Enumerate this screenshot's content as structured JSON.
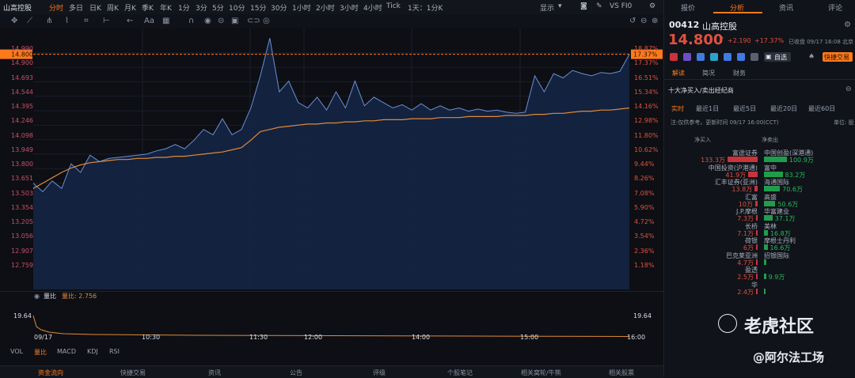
{
  "topbar": {
    "title": "山高控股",
    "periods": [
      "分时",
      "多日",
      "日K",
      "周K",
      "月K",
      "季K",
      "年K",
      "1分",
      "3分",
      "5分",
      "10分",
      "15分",
      "30分",
      "1小时",
      "2小时",
      "3小时",
      "4小时",
      "Tick",
      "1天：1分K"
    ],
    "active_period": "分时",
    "right_items": {
      "display": "显示",
      "vs": "VS FI0"
    }
  },
  "chart": {
    "y_left": [
      "14.990",
      "14.900",
      "14.693",
      "14.544",
      "14.395",
      "14.246",
      "14.098",
      "13.949",
      "13.800",
      "13.651",
      "13.503",
      "13.354",
      "13.205",
      "13.056",
      "12.907",
      "12.759"
    ],
    "y_right": [
      "18.87%",
      "17.37%",
      "16.51%",
      "15.34%",
      "14.16%",
      "12.98%",
      "11.80%",
      "10.62%",
      "9.44%",
      "8.26%",
      "7.08%",
      "5.90%",
      "4.72%",
      "3.54%",
      "2.36%",
      "1.18%"
    ],
    "current_price_label": "14.800",
    "current_pct_label": "17.37%"
  },
  "chart_data": {
    "type": "line",
    "title": "",
    "xlabel": "",
    "ylabel": "",
    "x_ticks": [
      "09/17",
      "10:30",
      "11:30",
      "12:00",
      "14:00",
      "15:00",
      "16:00"
    ],
    "ylim": [
      12.61,
      15.04
    ],
    "series": [
      {
        "values": [
          13.6,
          13.52,
          13.62,
          13.55,
          13.78,
          13.7,
          13.86,
          13.8,
          13.83,
          13.84,
          13.85,
          13.86,
          13.87,
          13.9,
          13.92,
          13.96,
          13.92,
          14.0,
          14.1,
          14.05,
          14.2,
          14.05,
          14.1,
          14.3,
          14.6,
          14.95,
          14.45,
          14.55,
          14.35,
          14.3,
          14.4,
          14.28,
          14.45,
          14.3,
          14.55,
          14.32,
          14.4,
          14.35,
          14.3,
          14.33,
          14.28,
          14.34,
          14.28,
          14.32,
          14.28,
          14.3,
          14.27,
          14.29,
          14.27,
          14.28,
          14.26,
          14.25,
          14.26,
          14.6,
          14.45,
          14.62,
          14.58,
          14.65,
          14.62,
          14.6,
          14.63,
          14.62,
          14.64,
          14.8
        ]
      },
      {
        "values": [
          13.55,
          13.6,
          13.65,
          13.7,
          13.74,
          13.77,
          13.79,
          13.8,
          13.81,
          13.82,
          13.82,
          13.83,
          13.83,
          13.84,
          13.84,
          13.85,
          13.85,
          13.86,
          13.87,
          13.88,
          13.89,
          13.91,
          13.93,
          14.0,
          14.08,
          14.1,
          14.12,
          14.13,
          14.14,
          14.15,
          14.15,
          14.16,
          14.16,
          14.17,
          14.17,
          14.18,
          14.18,
          14.19,
          14.19,
          14.19,
          14.2,
          14.2,
          14.2,
          14.21,
          14.21,
          14.21,
          14.22,
          14.22,
          14.22,
          14.22,
          14.23,
          14.23,
          14.23,
          14.24,
          14.24,
          14.25,
          14.25,
          14.26,
          14.27,
          14.27,
          14.28,
          14.28,
          14.29,
          14.3
        ]
      }
    ]
  },
  "volume": {
    "indicator_label": "量比",
    "value_label": "量比: 2.756",
    "left_value": "19.64",
    "right_value": "19.64"
  },
  "indicator_tabs": [
    "VOL",
    "量比",
    "MACD",
    "KDJ",
    "RSI"
  ],
  "active_indicator": "量比",
  "bottom_tabs": [
    "资金流向",
    "快捷交易",
    "资讯",
    "公告",
    "评级",
    "个股笔记",
    "相关窝轮/牛熊",
    "相关股票"
  ],
  "panel": {
    "tabs": [
      "报价",
      "分析",
      "资讯",
      "评论"
    ],
    "active_tab": "分析",
    "code": "00412",
    "name": "山高控股",
    "price": "14.800",
    "change": "+2.190",
    "change_pct": "+17.37%",
    "status": "已收盘 09/17 16:08 北京",
    "self_select": "自选",
    "quick_trade": "快捷交易",
    "sub_tabs": [
      "解读",
      "简况",
      "财务"
    ],
    "section_title": "十大净买入/卖出经纪商",
    "range_tabs": [
      "实时",
      "最近1日",
      "最近5日",
      "最近20日",
      "最近60日"
    ],
    "note": "注:仅供参考。更新时间 09/17 16:00(CCT)",
    "unit": "单位: 股",
    "col_headers": [
      "净买入",
      "净卖出"
    ],
    "brokers": [
      {
        "buy_name": "富途证券",
        "buy_val": "133.3万",
        "sell_name": "中国创盈(深港通)",
        "sell_val": "100.9万",
        "b": 1.0,
        "s": 0.76
      },
      {
        "buy_name": "中国投资(沪港通)",
        "buy_val": "41.9万",
        "sell_name": "富中",
        "sell_val": "83.2万",
        "b": 0.31,
        "s": 0.62
      },
      {
        "buy_name": "汇丰证券(亚洲)",
        "buy_val": "13.8万",
        "sell_name": "海通国际",
        "sell_val": "70.6万",
        "b": 0.1,
        "s": 0.53
      },
      {
        "buy_name": "汇富",
        "buy_val": "10万",
        "sell_name": "高盛",
        "sell_val": "50.6万",
        "b": 0.08,
        "s": 0.38
      },
      {
        "buy_name": "J.P.摩根",
        "buy_val": "7.3万",
        "sell_name": "华富建业",
        "sell_val": "37.1万",
        "b": 0.05,
        "s": 0.28
      },
      {
        "buy_name": "长桥",
        "buy_val": "7.1万",
        "sell_name": "美林",
        "sell_val": "16.8万",
        "b": 0.05,
        "s": 0.13
      },
      {
        "buy_name": "荷银",
        "buy_val": "6万",
        "sell_name": "摩根士丹利",
        "sell_val": "16.6万",
        "b": 0.045,
        "s": 0.12
      },
      {
        "buy_name": "巴克莱亚洲",
        "buy_val": "4.7万",
        "sell_name": "招银国际",
        "sell_val": "",
        "b": 0.035,
        "s": 0.09
      },
      {
        "buy_name": "盈透",
        "buy_val": "2.5万",
        "sell_name": "",
        "sell_val": "9.9万",
        "b": 0.02,
        "s": 0.07
      },
      {
        "buy_name": "华",
        "buy_val": "2.4万",
        "sell_name": "",
        "sell_val": "",
        "b": 0.02,
        "s": 0.05
      }
    ]
  },
  "watermark": {
    "line1": "老虎社区",
    "line2": "@阿尔法工场"
  },
  "colors": {
    "accent": "#ff7a1a",
    "up": "#e0513f",
    "line": "#6b8fd6",
    "avg": "#e08a3a",
    "buy": "#c9333a",
    "sell": "#1f9d4c"
  }
}
